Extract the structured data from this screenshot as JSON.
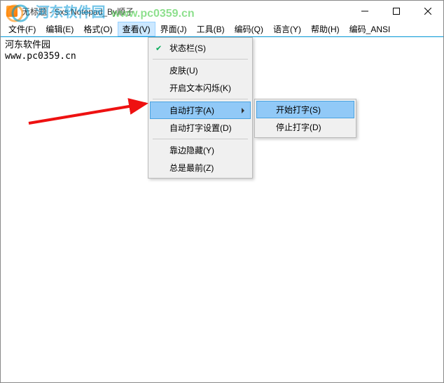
{
  "titlebar": {
    "title": "无标题 - Sxs Notepad_By顺子"
  },
  "menubar": {
    "items": [
      "文件(F)",
      "编辑(E)",
      "格式(O)",
      "查看(V)",
      "界面(J)",
      "工具(B)",
      "编码(Q)",
      "语言(Y)",
      "帮助(H)",
      "编码_ANSI"
    ],
    "active_index": 3
  },
  "editor": {
    "line1": "河东软件园",
    "line2": "www.pc0359.cn"
  },
  "watermark": {
    "text1": "河东软件园",
    "text2": "www.pc0359.cn"
  },
  "view_menu": {
    "items": [
      {
        "label": "状态栏(S)",
        "checked": true
      },
      {
        "sep": true
      },
      {
        "label": "皮肤(U)"
      },
      {
        "label": "开启文本闪烁(K)"
      },
      {
        "sep": true
      },
      {
        "label": "自动打字(A)",
        "submenu": true,
        "highlighted": true
      },
      {
        "label": "自动打字设置(D)"
      },
      {
        "sep": true
      },
      {
        "label": "靠边隐藏(Y)"
      },
      {
        "label": "总是最前(Z)"
      }
    ]
  },
  "sub_menu": {
    "items": [
      {
        "label": "开始打字(S)",
        "highlighted": true
      },
      {
        "label": "停止打字(D)"
      }
    ]
  }
}
